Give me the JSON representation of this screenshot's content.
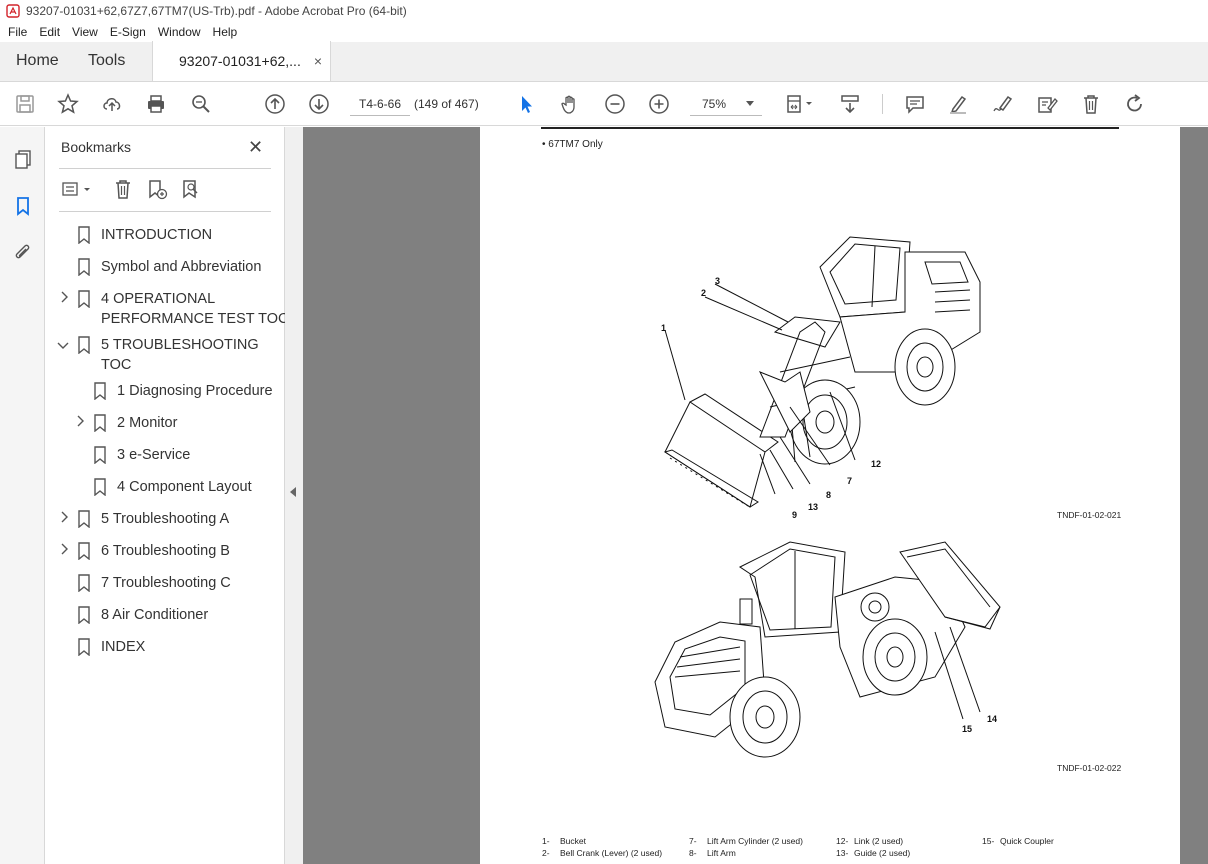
{
  "window": {
    "title": "93207-01031+62,67Z7,67TM7(US-Trb).pdf - Adobe Acrobat Pro (64-bit)"
  },
  "menu": [
    "File",
    "Edit",
    "View",
    "E-Sign",
    "Window",
    "Help"
  ],
  "tabs": {
    "home": "Home",
    "tools": "Tools",
    "document": "93207-01031+62,...",
    "close": "×"
  },
  "toolbar": {
    "page_label": "T4-6-66",
    "page_count": "(149 of 467)",
    "zoom": "75%"
  },
  "icons": {
    "save": "save-icon",
    "star": "star-icon",
    "upload": "upload-icon",
    "print": "print-icon",
    "find": "find-icon",
    "prev_page": "arrow-up-circle-icon",
    "next_page": "arrow-down-circle-icon",
    "select": "cursor-icon",
    "hand": "hand-icon",
    "zoom_out": "zoom-out-icon",
    "zoom_in": "zoom-in-icon",
    "page_display": "page-display-icon",
    "scroll_mode": "scroll-mode-icon",
    "comment": "comment-icon",
    "highlight": "highlight-icon",
    "sign": "sign-icon",
    "edit_pdf": "edit-pdf-icon",
    "delete": "trash-icon",
    "rotate": "rotate-icon"
  },
  "bookmarks": {
    "title": "Bookmarks",
    "close": "✕",
    "items": [
      {
        "label": "INTRODUCTION"
      },
      {
        "label": "Symbol and Abbreviation"
      },
      {
        "label": "4 OPERATIONAL",
        "label2": "PERFORMANCE TEST TOC"
      },
      {
        "label": "5 TROUBLESHOOTING",
        "label2": "TOC"
      },
      {
        "label": "1 Diagnosing Procedure"
      },
      {
        "label": "2 Monitor"
      },
      {
        "label": "3 e-Service"
      },
      {
        "label": "4 Component Layout"
      },
      {
        "label": "5 Troubleshooting A"
      },
      {
        "label": "6 Troubleshooting B"
      },
      {
        "label": "7 Troubleshooting C"
      },
      {
        "label": "8 Air Conditioner"
      },
      {
        "label": "INDEX"
      }
    ]
  },
  "page": {
    "note": "• 67TM7 Only",
    "fig1_code": "TNDF-01-02-021",
    "fig2_code": "TNDF-01-02-022",
    "fig1_callouts": [
      "1",
      "2",
      "3",
      "7",
      "8",
      "9",
      "12",
      "13"
    ],
    "fig2_callouts": [
      "14",
      "15"
    ],
    "legend": [
      [
        "1-",
        "Bucket"
      ],
      [
        "2-",
        "Bell Crank (Lever) (2 used)"
      ],
      [
        "7-",
        "Lift Arm Cylinder (2 used)"
      ],
      [
        "8-",
        "Lift Arm"
      ],
      [
        "12-",
        "Link (2 used)"
      ],
      [
        "13-",
        "Guide (2 used)"
      ],
      [
        "15-",
        "Quick Coupler"
      ]
    ]
  }
}
